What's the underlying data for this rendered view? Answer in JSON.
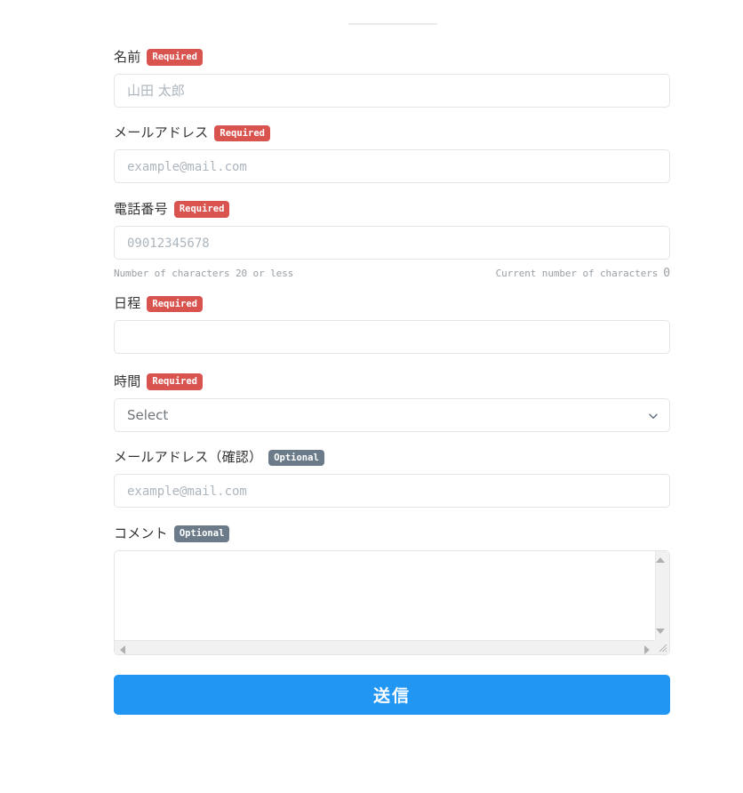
{
  "badges": {
    "required": "Required",
    "optional": "Optional",
    "required_color": "#d9534f",
    "optional_color": "#6c7b8a"
  },
  "theme": {
    "submit_color": "#2196f3",
    "border_color": "#e3e5e8",
    "placeholder_color": "#adb5bd",
    "hint_color": "#9aa0a6"
  },
  "form": {
    "fields": [
      {
        "key": "name",
        "label": "名前",
        "badge": "Required",
        "badge_kind": "required",
        "type": "text",
        "value": "",
        "placeholder": "山田 太郎"
      },
      {
        "key": "email",
        "label": "メールアドレス",
        "badge": "Required",
        "badge_kind": "required",
        "type": "email",
        "value": "",
        "placeholder": "example@mail.com"
      },
      {
        "key": "tel",
        "label": "電話番号",
        "badge": "Required",
        "badge_kind": "required",
        "type": "tel",
        "value": "",
        "placeholder": "09012345678",
        "hint_left": "Number of characters 20 or less",
        "hint_right_label": "Current number of characters",
        "hint_right_count": "0"
      },
      {
        "key": "schedule",
        "label": "日程",
        "badge": "Required",
        "badge_kind": "required",
        "type": "text",
        "value": "",
        "placeholder": ""
      },
      {
        "key": "time",
        "label": "時間",
        "badge": "Required",
        "badge_kind": "required",
        "type": "select",
        "value": "Select",
        "options": [
          "Select"
        ],
        "icon": "chevron-down-icon"
      },
      {
        "key": "email_confirm",
        "label": "メールアドレス（確認）",
        "badge": "Optional",
        "badge_kind": "optional",
        "type": "email",
        "value": "",
        "placeholder": "example@mail.com"
      },
      {
        "key": "comment",
        "label": "コメント",
        "badge": "Optional",
        "badge_kind": "optional",
        "type": "textarea",
        "value": "",
        "placeholder": ""
      }
    ],
    "submit_label": "送信"
  }
}
